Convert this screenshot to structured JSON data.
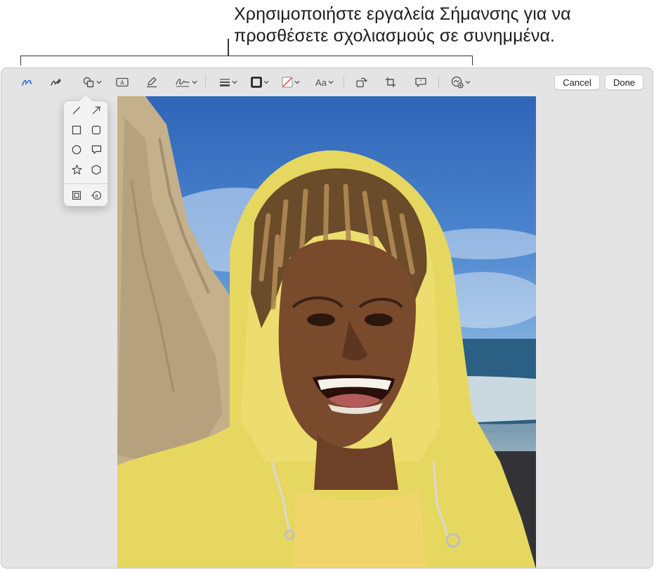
{
  "callout": {
    "text": "Χρησιμοποιήστε εργαλεία Σήμανσης για να προσθέσετε σχολιασμούς σε συνημμένα."
  },
  "toolbar": {
    "tools": [
      {
        "name": "sketch-icon",
        "active": true
      },
      {
        "name": "draw-icon"
      },
      {
        "name": "shapes-icon",
        "menu": true
      },
      {
        "name": "text-box-icon"
      },
      {
        "name": "highlight-icon"
      },
      {
        "name": "signature-icon",
        "menu": true
      },
      {
        "name": "shape-style-icon",
        "menu": true
      },
      {
        "name": "border-color-icon",
        "menu": true
      },
      {
        "name": "fill-color-icon",
        "menu": true
      },
      {
        "name": "text-style-icon",
        "menu": true
      },
      {
        "name": "rotate-icon"
      },
      {
        "name": "crop-icon"
      },
      {
        "name": "description-icon"
      },
      {
        "name": "markup-more-icon",
        "menu": true
      }
    ],
    "text_style_label": "Aa",
    "cancel_label": "Cancel",
    "done_label": "Done"
  },
  "shapes_menu": {
    "items": [
      "line-icon",
      "arrow-icon",
      "square-icon",
      "rounded-square-icon",
      "circle-icon",
      "speech-bubble-icon",
      "star-icon",
      "hexagon-icon",
      "mask-icon",
      "loupe-icon"
    ]
  },
  "colors": {
    "accent": "#2f6fe0",
    "window_bg": "#e4e4e4",
    "hood_yellow": "#e8d85a",
    "sky_blue": "#3c78c6"
  }
}
